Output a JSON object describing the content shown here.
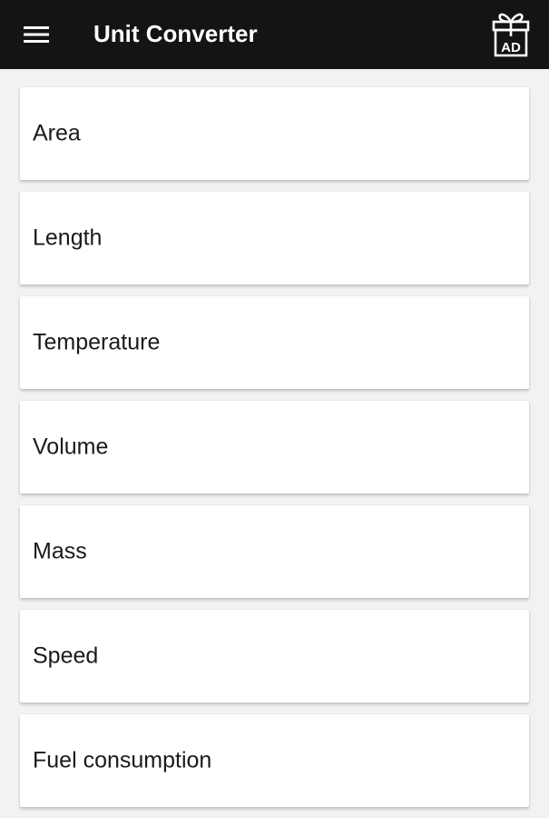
{
  "app_bar": {
    "title": "Unit Converter",
    "menu_icon": "hamburger-menu-icon",
    "ad_icon": "gift-ad-icon",
    "ad_label": "AD",
    "background_color": "#141414"
  },
  "categories": [
    {
      "label": "Area"
    },
    {
      "label": "Length"
    },
    {
      "label": "Temperature"
    },
    {
      "label": "Volume"
    },
    {
      "label": "Mass"
    },
    {
      "label": "Speed"
    },
    {
      "label": "Fuel consumption"
    }
  ]
}
